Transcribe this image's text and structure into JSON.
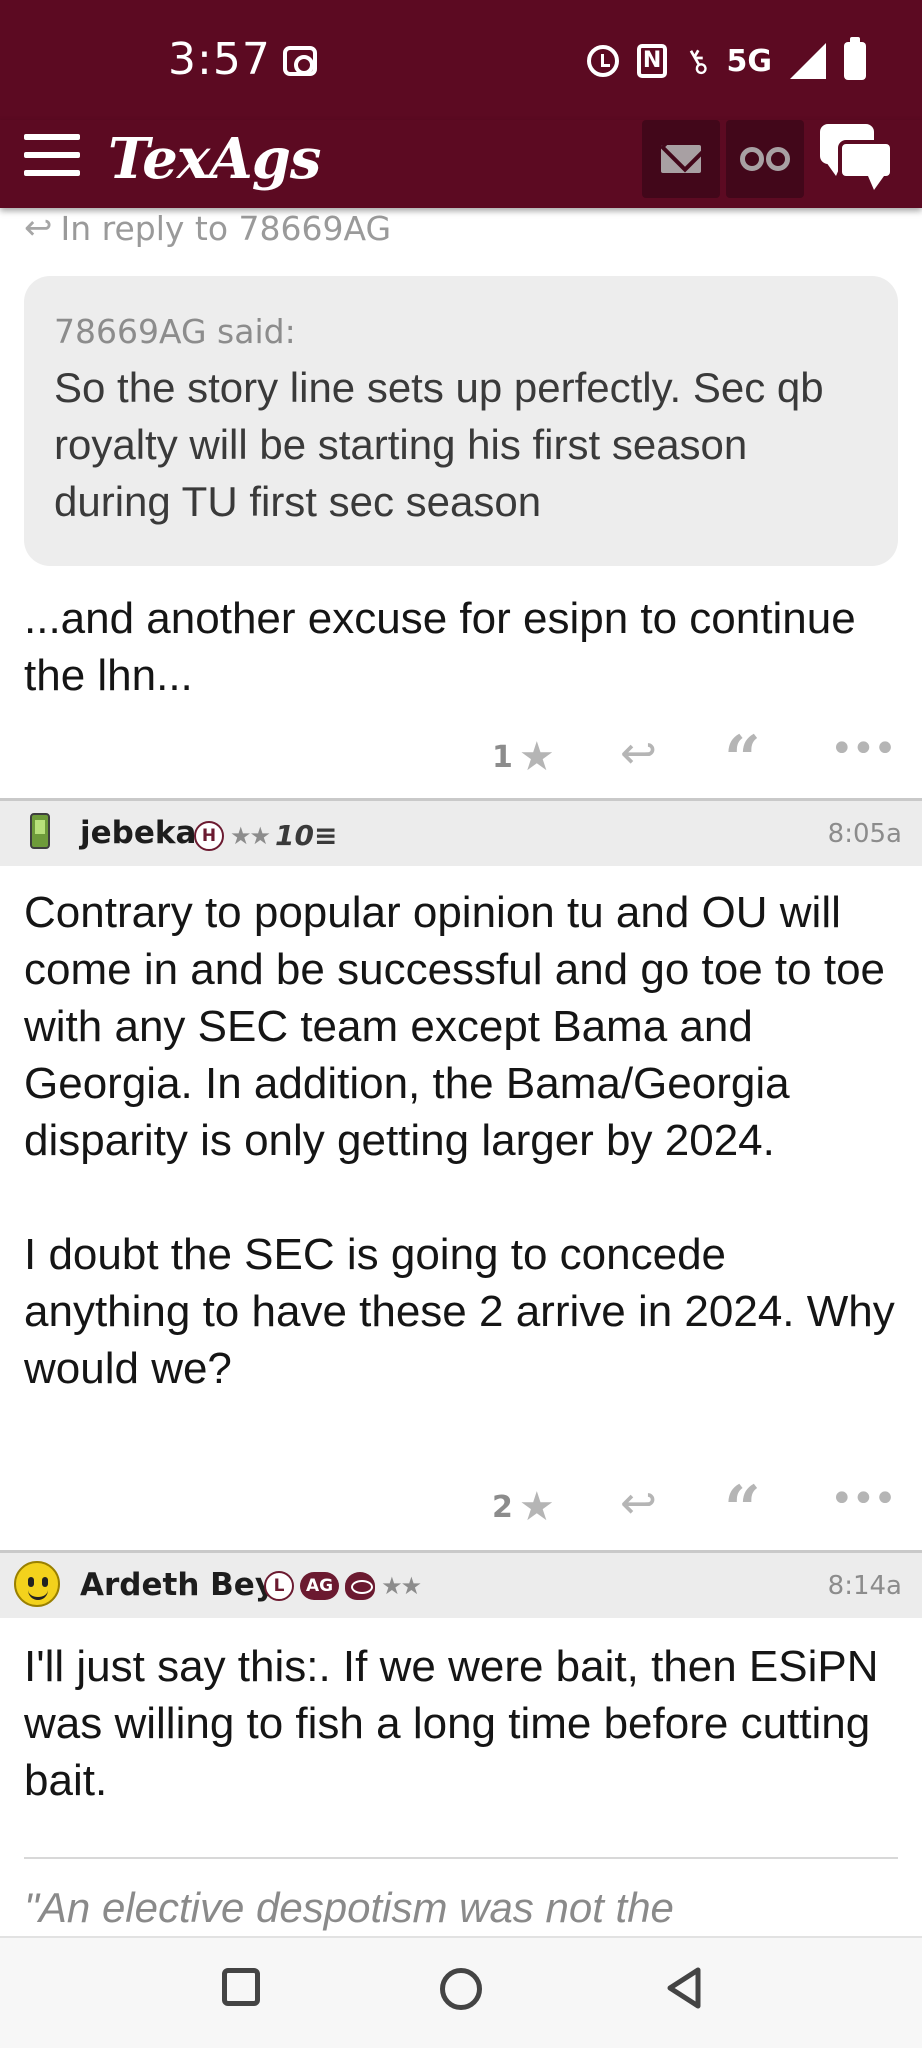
{
  "status_bar": {
    "time": "3:57",
    "network": "5G",
    "icons": [
      "screen-record-icon",
      "alarm-icon",
      "nfc-icon",
      "vpn-key-icon",
      "signal-icon",
      "battery-icon"
    ]
  },
  "app_bar": {
    "logo": "TexAgs",
    "icons": [
      "menu-icon",
      "mail-icon",
      "binoculars-icon",
      "chat-icon"
    ],
    "color": "#5c0a22"
  },
  "thread": {
    "reply_to": "In reply to 78669AG",
    "quote": {
      "author": "78669AG said:",
      "text": "So the story line sets up perfectly. Sec qb royalty will be starting his first season during TU first sec season"
    },
    "first_post": {
      "body": "...and another excuse for esipn to continue the lhn...",
      "likes": "1"
    },
    "posts": [
      {
        "username": "jebeka",
        "badge_letter": "H",
        "stars": "★★",
        "rank": "10",
        "time": "8:05a",
        "body": "Contrary to popular opinion tu and OU will come in and be successful and go toe to toe with any SEC team except Bama and Georgia. In addition, the Bama/Georgia disparity is only getting larger by 2024.\n\nI doubt the SEC is going to concede anything to have these 2 arrive in 2024. Why would we?",
        "likes": "2"
      },
      {
        "username": "Ardeth Bey",
        "badge_letter": "L",
        "badge_ag": "AG",
        "stars": "★★",
        "time": "8:14a",
        "body": "I'll just say this:. If we were bait, then ESiPN was willing to fish a long time before cutting bait.",
        "signature": "\"An elective despotism was not the"
      }
    ]
  },
  "nav_bar": {
    "icons": [
      "recents-icon",
      "home-icon",
      "back-icon"
    ]
  }
}
